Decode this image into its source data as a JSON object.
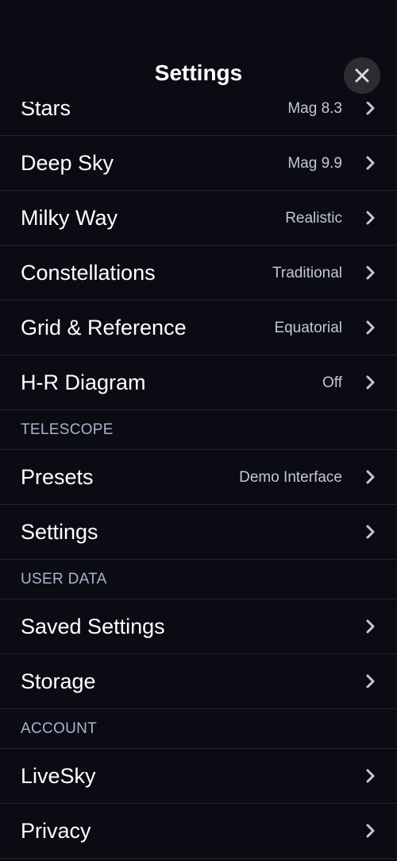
{
  "header": {
    "title": "Settings"
  },
  "display": [
    {
      "label": "Stars",
      "value": "Mag 8.3"
    },
    {
      "label": "Deep Sky",
      "value": "Mag 9.9"
    },
    {
      "label": "Milky Way",
      "value": "Realistic"
    },
    {
      "label": "Constellations",
      "value": "Traditional"
    },
    {
      "label": "Grid & Reference",
      "value": "Equatorial"
    },
    {
      "label": "H-R Diagram",
      "value": "Off"
    }
  ],
  "telescope": {
    "header": "TELESCOPE",
    "items": [
      {
        "label": "Presets",
        "value": "Demo Interface"
      },
      {
        "label": "Settings",
        "value": ""
      }
    ]
  },
  "user_data": {
    "header": "USER DATA",
    "items": [
      {
        "label": "Saved Settings",
        "value": ""
      },
      {
        "label": "Storage",
        "value": ""
      }
    ]
  },
  "account": {
    "header": "ACCOUNT",
    "items": [
      {
        "label": "LiveSky",
        "value": ""
      },
      {
        "label": "Privacy",
        "value": ""
      }
    ]
  },
  "icons": {
    "close": "close-icon",
    "chevron": "chevron-right-icon"
  },
  "colors": {
    "background": "#0b0b14",
    "separator": "#24242c",
    "value_text": "#c3c7d4",
    "section_text": "#a9b3cc",
    "close_button_bg": "#2c2c33"
  }
}
